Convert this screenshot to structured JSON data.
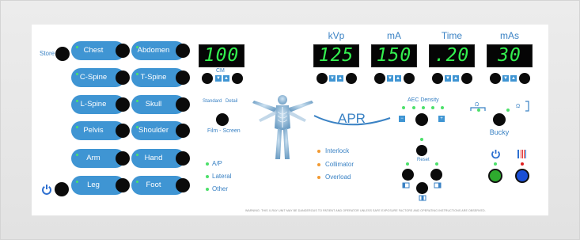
{
  "left": {
    "store": "Store",
    "body_parts": [
      "Chest",
      "Abdomen",
      "C-Spine",
      "T-Spine",
      "L-Spine",
      "Skull",
      "Pelvis",
      "Shoulder",
      "Arm",
      "Hand",
      "Leg",
      "Foot"
    ]
  },
  "cm": {
    "value": "100",
    "label": "CM"
  },
  "displays": [
    {
      "label": "kVp",
      "value": "125"
    },
    {
      "label": "mA",
      "value": "150"
    },
    {
      "label": "Time",
      "value": ".20"
    },
    {
      "label": "mAs",
      "value": "30"
    }
  ],
  "film_screen": {
    "standard": "Standard",
    "detail": "Detail",
    "label": "Film - Screen"
  },
  "apr": "APR",
  "views": [
    "A/P",
    "Lateral",
    "Other"
  ],
  "indicators": [
    "Interlock",
    "Collimator",
    "Overload"
  ],
  "aec": {
    "label": "AEC Density",
    "reset": "Reset"
  },
  "bucky": {
    "label": "Bucky"
  },
  "warning": "WARNING: THIS X-RAY UNIT MAY BE DANGEROUS TO PATIENT AND OPERATOR UNLESS SAFE EXPOSURE FACTORS AND OPERATING INSTRUCTIONS ARE OBSERVED.",
  "colors": {
    "accent": "#3f95d3",
    "led": "#33f04f",
    "indicator": "#f29a32",
    "ready_button": "#2eaa2e",
    "expose_button": "#1a4fd6"
  }
}
